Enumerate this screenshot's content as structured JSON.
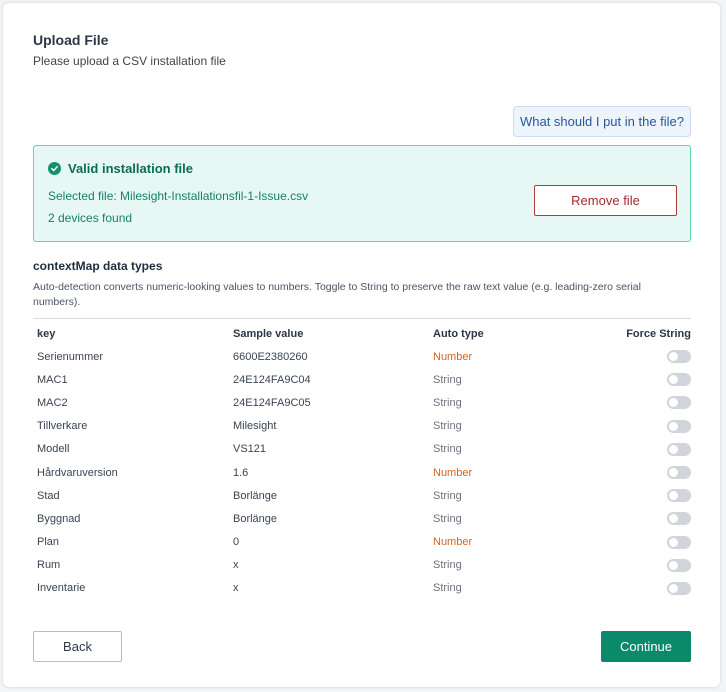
{
  "header": {
    "title": "Upload File",
    "subtitle": "Please upload a CSV installation file"
  },
  "help_button": "What should I put in the file?",
  "validation": {
    "title": "Valid installation file",
    "selected_file": "Selected file: Milesight-Installationsfil-1-Issue.csv",
    "devices_found": "2 devices found",
    "remove_label": "Remove file",
    "icon": "check-circle-icon"
  },
  "context_map": {
    "title": "contextMap data types",
    "description": "Auto-detection converts numeric-looking values to numbers. Toggle to String to preserve the raw text value (e.g. leading-zero serial numbers).",
    "columns": [
      "key",
      "Sample value",
      "Auto type",
      "Force String"
    ],
    "rows": [
      {
        "key": "Serienummer",
        "sample": "6600E2380260",
        "type": "Number",
        "force_string": false
      },
      {
        "key": "MAC1",
        "sample": "24E124FA9C04",
        "type": "String",
        "force_string": false
      },
      {
        "key": "MAC2",
        "sample": "24E124FA9C05",
        "type": "String",
        "force_string": false
      },
      {
        "key": "Tillverkare",
        "sample": "Milesight",
        "type": "String",
        "force_string": false
      },
      {
        "key": "Modell",
        "sample": "VS121",
        "type": "String",
        "force_string": false
      },
      {
        "key": "Hårdvaruversion",
        "sample": "1.6",
        "type": "Number",
        "force_string": false
      },
      {
        "key": "Stad",
        "sample": "Borlänge",
        "type": "String",
        "force_string": false
      },
      {
        "key": "Byggnad",
        "sample": "Borlänge",
        "type": "String",
        "force_string": false
      },
      {
        "key": "Plan",
        "sample": "0",
        "type": "Number",
        "force_string": false
      },
      {
        "key": "Rum",
        "sample": "x",
        "type": "String",
        "force_string": false
      },
      {
        "key": "Inventarie",
        "sample": "x",
        "type": "String",
        "force_string": false
      }
    ]
  },
  "footer": {
    "back_label": "Back",
    "continue_label": "Continue"
  },
  "colors": {
    "accent": "#0a8a6b",
    "number_type": "#d9631c",
    "danger": "#b23a3a"
  }
}
